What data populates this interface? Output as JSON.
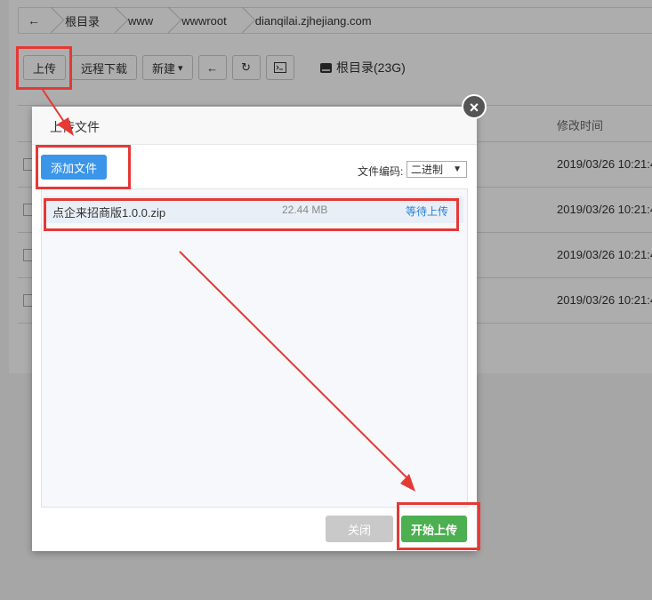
{
  "breadcrumb": {
    "back_icon": "arrow-left-icon",
    "items": [
      "根目录",
      "www",
      "wwwroot",
      "dianqilai.zjhejiang.com"
    ]
  },
  "toolbar": {
    "upload": "上传",
    "remote_download": "远程下载",
    "new": "新建",
    "new_caret": "▾",
    "back_icon": "arrow-left-icon",
    "refresh_icon": "refresh-icon",
    "terminal_icon": "terminal-icon"
  },
  "disk": {
    "label": "根目录(23G)",
    "icon": "hard-drive-icon"
  },
  "table": {
    "header_time": "修改时间",
    "rows": [
      {
        "time": "2019/03/26 10:21:4"
      },
      {
        "time": "2019/03/26 10:21:4"
      },
      {
        "time": "2019/03/26 10:21:4"
      },
      {
        "time": "2019/03/26 10:21:4"
      }
    ]
  },
  "dialog": {
    "title": "上传文件",
    "close_icon": "close-icon",
    "close_glyph": "×",
    "add_file": "添加文件",
    "encoding_label": "文件编码:",
    "encoding_value": "二进制",
    "file": {
      "name": "点企来招商版1.0.0.zip",
      "size": "22.44 MB",
      "status": "等待上传"
    },
    "close_button": "关闭",
    "start_button": "开始上传"
  },
  "colors": {
    "primary_blue": "#3b95e8",
    "start_green": "#4caf50",
    "annotation_red": "#e53935",
    "status_blue": "#2a7fd4"
  }
}
